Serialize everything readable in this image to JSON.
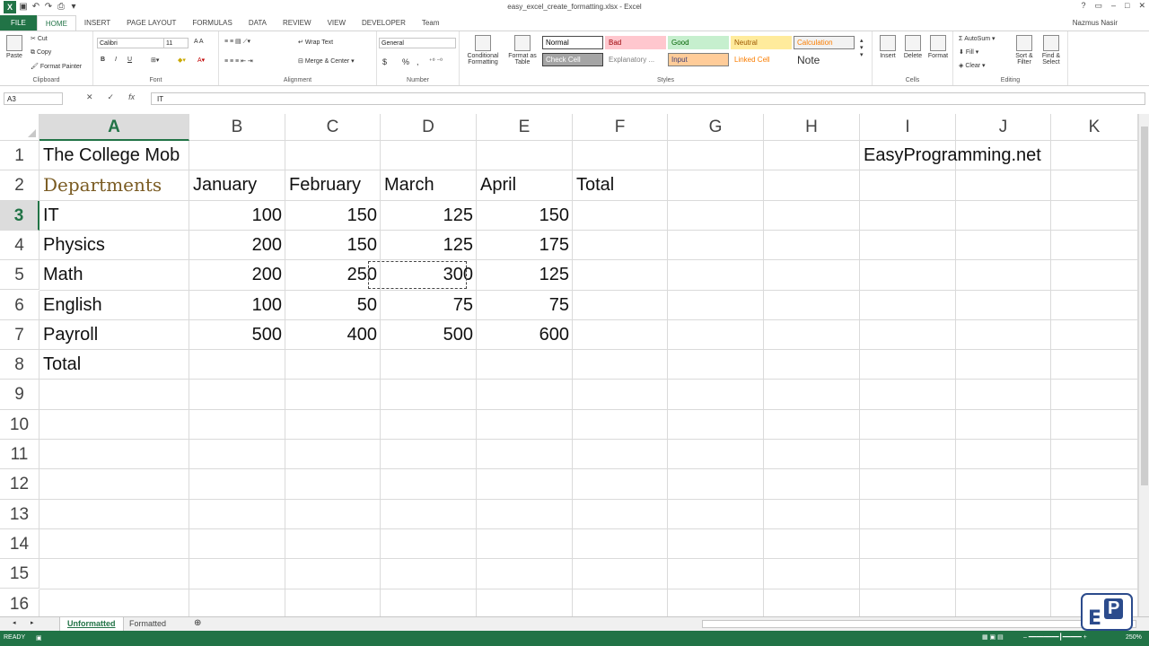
{
  "window": {
    "title": "easy_excel_create_formatting.xlsx - Excel",
    "user": "Nazmus Nasir",
    "controls": [
      "?",
      "▭",
      "–",
      "□",
      "✕"
    ]
  },
  "qat": {
    "icons": [
      "excel-logo",
      "save-icon",
      "undo-icon",
      "redo-icon"
    ]
  },
  "ribbon_tabs": [
    "FILE",
    "HOME",
    "INSERT",
    "PAGE LAYOUT",
    "FORMULAS",
    "DATA",
    "REVIEW",
    "VIEW",
    "DEVELOPER",
    "Team"
  ],
  "ribbon": {
    "clipboard": {
      "label": "Clipboard",
      "paste": "Paste",
      "cut": "Cut",
      "copy": "Copy",
      "format_painter": "Format Painter"
    },
    "font": {
      "label": "Font",
      "family": "Calibri",
      "size": "11",
      "bold": "B",
      "italic": "I",
      "underline": "U"
    },
    "alignment": {
      "label": "Alignment",
      "wrap": "Wrap Text",
      "merge": "Merge & Center"
    },
    "number": {
      "label": "Number",
      "format": "General",
      "currency": "$",
      "percent": "%",
      "comma": ","
    },
    "styles": {
      "label": "Styles",
      "conditional": "Conditional Formatting",
      "format_table": "Format as Table",
      "cells": [
        {
          "label": "Normal",
          "bg": "#ffffff",
          "fg": "#000000",
          "border": "#4a4a4a"
        },
        {
          "label": "Bad",
          "bg": "#ffc7ce",
          "fg": "#9c0006",
          "border": "#ffc7ce"
        },
        {
          "label": "Good",
          "bg": "#c6efce",
          "fg": "#006100",
          "border": "#c6efce"
        },
        {
          "label": "Neutral",
          "bg": "#ffeb9c",
          "fg": "#9c5700",
          "border": "#ffeb9c"
        },
        {
          "label": "Calculation",
          "bg": "#f2f2f2",
          "fg": "#fa7d00",
          "border": "#7f7f7f"
        },
        {
          "label": "Check Cell",
          "bg": "#a5a5a5",
          "fg": "#ffffff",
          "border": "#3f3f3f"
        },
        {
          "label": "Explanatory ...",
          "bg": "#ffffff",
          "fg": "#7f7f7f",
          "border": "#ffffff"
        },
        {
          "label": "Input",
          "bg": "#ffcc99",
          "fg": "#3f3f76",
          "border": "#7f7f7f"
        },
        {
          "label": "Linked Cell",
          "bg": "#ffffff",
          "fg": "#fa7d00",
          "border": "#ffffff"
        },
        {
          "label": "Note",
          "bg": "#ffffff",
          "fg": "#333333",
          "border": "#ffffff"
        }
      ]
    },
    "cells": {
      "label": "Cells",
      "insert": "Insert",
      "delete": "Delete",
      "format": "Format"
    },
    "editing": {
      "label": "Editing",
      "autosum": "AutoSum",
      "fill": "Fill",
      "clear": "Clear",
      "sort": "Sort & Filter",
      "find": "Find & Select"
    }
  },
  "formula_bar": {
    "name_box": "A3",
    "cancel": "✕",
    "enter": "✓",
    "fx": "fx",
    "value": "IT"
  },
  "columns": [
    "A",
    "B",
    "C",
    "D",
    "E",
    "F",
    "G",
    "H",
    "I",
    "J",
    "K"
  ],
  "rows": [
    "1",
    "2",
    "3",
    "4",
    "5",
    "6",
    "7",
    "8",
    "9",
    "10",
    "11",
    "12",
    "13",
    "14",
    "15",
    "16"
  ],
  "cells": {
    "r1": {
      "a": "The College Mob",
      "i": "EasyProgramming.net"
    },
    "r2": {
      "a": "Departments",
      "b": "January",
      "c": "February",
      "d": "March",
      "e": "April",
      "f": "Total"
    },
    "r3": {
      "a": "IT",
      "b": "100",
      "c": "150",
      "d": "125",
      "e": "150"
    },
    "r4": {
      "a": "Physics",
      "b": "200",
      "c": "150",
      "d": "125",
      "e": "175"
    },
    "r5": {
      "a": "Math",
      "b": "200",
      "c": "250",
      "d": "300",
      "e": "125"
    },
    "r6": {
      "a": "English",
      "b": "100",
      "c": "50",
      "d": "75",
      "e": "75"
    },
    "r7": {
      "a": "Payroll",
      "b": "500",
      "c": "400",
      "d": "500",
      "e": "600"
    },
    "r8": {
      "a": "Total"
    }
  },
  "sheets": [
    "Unformatted",
    "Formatted"
  ],
  "status": {
    "mode": "READY",
    "zoom": "250%"
  },
  "watermark": {
    "text": "EP"
  }
}
